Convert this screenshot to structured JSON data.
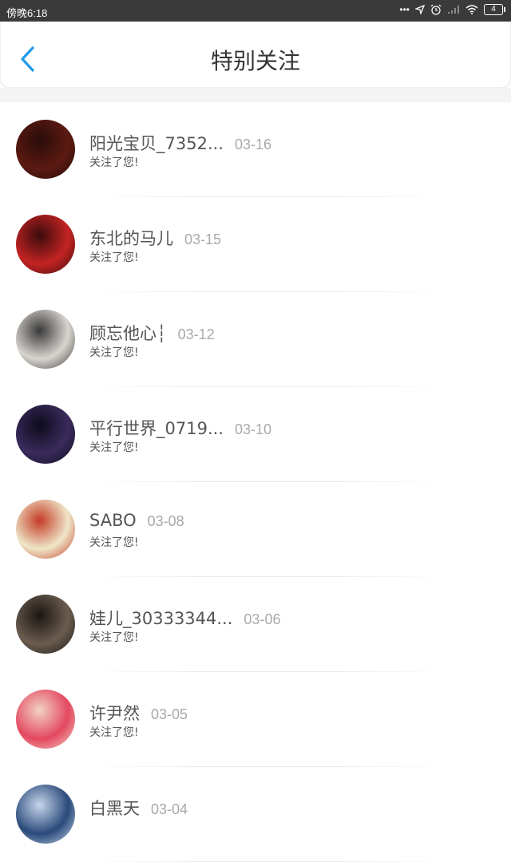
{
  "status_bar": {
    "time": "傍晚6:18",
    "dots": "•••",
    "battery": "4"
  },
  "header": {
    "title": "特别关注"
  },
  "items": [
    {
      "name": "阳光宝贝_7352...",
      "date": "03-16",
      "desc": "关注了您!",
      "color_a": "#5b1a12",
      "color_b": "#2a0c08"
    },
    {
      "name": "东北的马儿",
      "date": "03-15",
      "desc": "关注了您!",
      "color_a": "#c42323",
      "color_b": "#3b0c0c"
    },
    {
      "name": "顾忘他心┆",
      "date": "03-12",
      "desc": "关注了您!",
      "color_a": "#d9d4cf",
      "color_b": "#3a3a3a"
    },
    {
      "name": "平行世界_0719...",
      "date": "03-10",
      "desc": "关注了您!",
      "color_a": "#3a2b5c",
      "color_b": "#0d0b1c"
    },
    {
      "name": "SABO",
      "date": "03-08",
      "desc": "关注了您!",
      "color_a": "#efe6c8",
      "color_b": "#c43b26"
    },
    {
      "name": "娃儿_30333344...",
      "date": "03-06",
      "desc": "关注了您!",
      "color_a": "#6b5d4f",
      "color_b": "#1b1512"
    },
    {
      "name": "许尹然",
      "date": "03-05",
      "desc": "关注了您!",
      "color_a": "#e44860",
      "color_b": "#f2d3c5"
    },
    {
      "name": "白黑天",
      "date": "03-04",
      "desc": "",
      "color_a": "#2b4a7a",
      "color_b": "#c7d6ec"
    }
  ]
}
